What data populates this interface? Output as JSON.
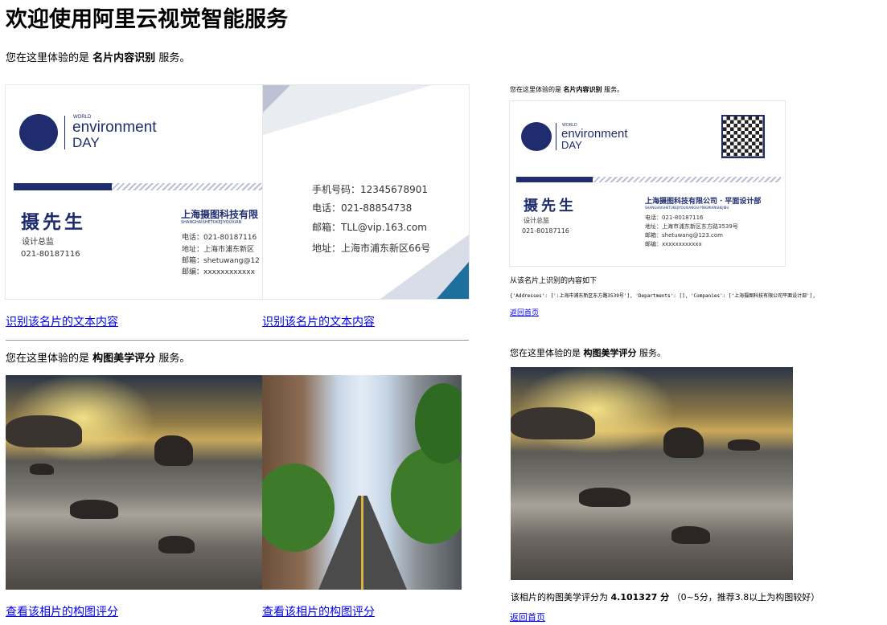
{
  "header": {
    "title": "欢迎使用阿里云视觉智能服务"
  },
  "left": {
    "intro_prefix": "您在这里体验的是",
    "intro_service": "名片内容识别",
    "intro_suffix": "服务。",
    "card1": {
      "logo_world": "WORLD",
      "logo_env": "environment",
      "logo_day": "DAY",
      "logo_sub": "SHANGHAISHETUKEJIYOUXIAN",
      "name": "摄先生",
      "title": "设计总监",
      "phone": "021-80187116",
      "company": "上海摄图科技有限",
      "lines": [
        "电话：021-80187116",
        "地址：上海市浦东新区",
        "邮箱：shetuwang@12",
        "邮编：xxxxxxxxxxxx"
      ]
    },
    "card2": {
      "lines": [
        "手机号码：12345678901",
        "电话：021-88854738",
        "邮箱：TLL@vip.163.com",
        "地址：上海市浦东新区66号"
      ]
    },
    "link1": "识别该名片的文本内容",
    "link2": "识别该名片的文本内容",
    "intro2_prefix": "您在这里体验的是",
    "intro2_service": "构图美学评分",
    "intro2_suffix": "服务。",
    "photo_link1": "查看该相片的构图评分",
    "photo_link2": "查看该相片的构图评分"
  },
  "right": {
    "intro_prefix": "您在这里体验的是",
    "intro_service": "名片内容识别",
    "intro_suffix": "服务。",
    "card": {
      "logo_world": "WORLD",
      "logo_env": "environment",
      "logo_day": "DAY",
      "name": "摄先生",
      "title": "设计总监",
      "phone": "021-80187116",
      "company": "上海摄图科技有限公司 · 平面设计部",
      "company_sub": "SHANGHAISHETUKEJIYOUXIANGSI PINGMIANSHEJIBU",
      "lines": [
        "电话：021-80187116",
        "地址：上海市浦东新区东方路3539号",
        "邮箱：shetuwang@123.com",
        "邮编：xxxxxxxxxxxx"
      ]
    },
    "result_heading": "从该名片上识别的内容如下",
    "result_text": "{'Addresses': [':上海市浦东新区东方路3539号'], 'Departments': [], 'Companies': ['上海摄图科技有限公司平面设计部'],",
    "back_link1": "返回首页",
    "intro2_prefix": "您在这里体验的是",
    "intro2_service": "构图美学评分",
    "intro2_suffix": "服务。",
    "score_prefix": "该相片的构图美学评分为",
    "score_value": "4.101327 分",
    "score_suffix": "（0~5分，推荐3.8以上为构图较好）",
    "back_link2": "返回首页"
  },
  "colors": {
    "brand_navy": "#1f2d6e",
    "link": "#0000ee"
  }
}
